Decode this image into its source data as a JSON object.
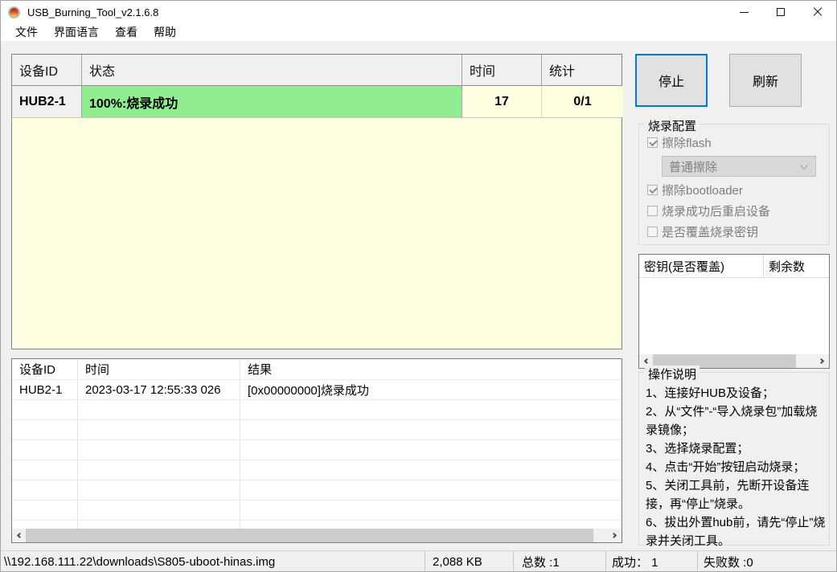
{
  "window": {
    "title": "USB_Burning_Tool_v2.1.6.8"
  },
  "menu": {
    "items": [
      "文件",
      "界面语言",
      "查看",
      "帮助"
    ]
  },
  "device_table": {
    "headers": {
      "device": "设备ID",
      "status": "状态",
      "time": "时间",
      "stats": "统计"
    },
    "row": {
      "device": "HUB2-1",
      "status": "100%:烧录成功",
      "time": "17",
      "stats": "0/1"
    }
  },
  "actions": {
    "stop": "停止",
    "refresh": "刷新"
  },
  "burn_config": {
    "title": "烧录配置",
    "erase_flash_label": "擦除flash",
    "erase_mode_value": "普通擦除",
    "erase_bootloader_label": "擦除bootloader",
    "reboot_label": "烧录成功后重启设备",
    "overwrite_key_label": "是否覆盖烧录密钥"
  },
  "key_table": {
    "headers": {
      "key": "密钥(是否覆盖)",
      "remaining": "剩余数"
    }
  },
  "instructions": {
    "title": "操作说明",
    "lines": [
      "1、连接好HUB及设备；",
      "2、从“文件”-“导入烧录包”加载烧录镜像；",
      "3、选择烧录配置；",
      "4、点击“开始”按钮启动烧录；",
      "5、关闭工具前，先断开设备连接，再“停止”烧录。",
      "6、拔出外置hub前，请先“停止”烧录并关闭工具。"
    ]
  },
  "log_table": {
    "headers": {
      "device": "设备ID",
      "time": "时间",
      "result": "结果"
    },
    "row": {
      "device": "HUB2-1",
      "time": "2023-03-17 12:55:33 026",
      "result": "[0x00000000]烧录成功"
    }
  },
  "status_bar": {
    "file_path": "\\\\192.168.111.22\\downloads\\S805-uboot-hinas.img",
    "file_size": "2,088 KB",
    "total": "总数 :1",
    "success": "成功： 1",
    "failed": "失败数 :0"
  },
  "colors": {
    "success_green": "#90ee90",
    "panel_yellow": "#ffffe1",
    "focus_blue": "#0078d7"
  }
}
